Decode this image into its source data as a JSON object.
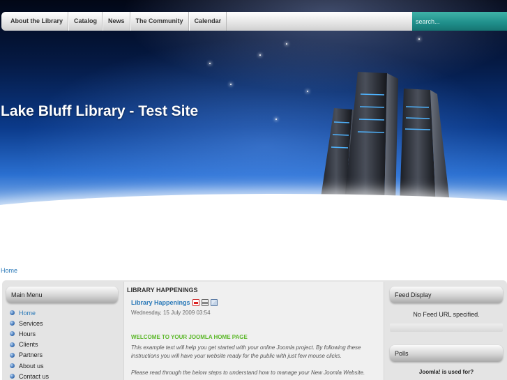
{
  "nav": {
    "items": [
      "About the Library",
      "Catalog",
      "News",
      "The Community",
      "Calendar"
    ]
  },
  "search": {
    "placeholder": "search..."
  },
  "site": {
    "title": "Lake Bluff Library - Test Site"
  },
  "breadcrumb": {
    "home": "Home"
  },
  "main_menu": {
    "title": "Main Menu",
    "items": [
      "Home",
      "Services",
      "Hours",
      "Clients",
      "Partners",
      "About us",
      "Contact us"
    ],
    "active_index": 0
  },
  "content": {
    "section_title": "LIBRARY HAPPENINGS",
    "article_title": "Library Happenings",
    "article_date": "Wednesday, 15 July 2009 03:54",
    "icons": [
      "pdf-icon",
      "print-icon",
      "email-icon"
    ],
    "welcome_heading": "WELCOME TO YOUR JOOMLA HOME PAGE",
    "paragraph1": "This example text will help you get started with your online Joomla project. By following these instructions you will have your website ready for the public with just few mouse clicks.",
    "paragraph2": "Please read through the below steps to understand how to manage your New Joomla Website."
  },
  "feed": {
    "title": "Feed Display",
    "message": "No Feed URL specified."
  },
  "polls": {
    "title": "Polls",
    "question": "Joomla! is used for?"
  },
  "colors": {
    "link": "#2a79b8",
    "welcome_green": "#5cb82a",
    "search_teal": "#1f8e8a",
    "header_blue": "#0b3a8a"
  }
}
